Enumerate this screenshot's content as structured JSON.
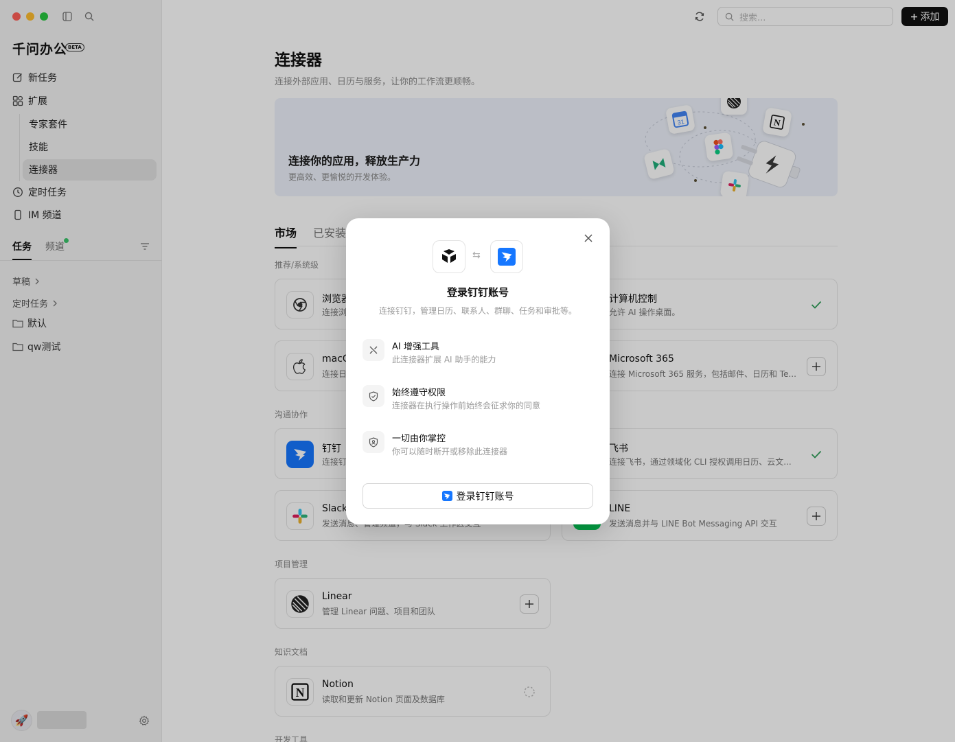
{
  "app": {
    "name": "千问办公",
    "badge": "BETA"
  },
  "sidebar": {
    "nav": {
      "new_task": "新任务",
      "extensions": "扩展",
      "scheduled": "定时任务",
      "im_channel": "IM 频道"
    },
    "sub": {
      "expert_kits": "专家套件",
      "skills": "技能",
      "connectors": "连接器"
    },
    "tabs": {
      "tasks": "任务",
      "channels": "频道"
    },
    "lists": {
      "drafts": "草稿",
      "scheduled": "定时任务",
      "default": "默认",
      "qw_test": "qw测试"
    }
  },
  "topbar": {
    "search_placeholder": "搜索...",
    "add_label": "添加"
  },
  "page": {
    "title": "连接器",
    "subtitle": "连接外部应用、日历与服务，让你的工作流更顺畅。",
    "banner": {
      "title": "连接你的应用，释放生产力",
      "subtitle": "更高效、更愉悦的开发体验。"
    },
    "tabs": {
      "market": "市场",
      "installed": "已安装"
    },
    "sections": {
      "recommended": "推荐/系统级",
      "communication": "沟通协作",
      "project": "项目管理",
      "knowledge": "知识文档",
      "dev": "开发工具"
    },
    "cards": {
      "browser": {
        "name": "浏览器",
        "desc": "连接浏"
      },
      "computer": {
        "name": "计算机控制",
        "desc": "允许 AI 操作桌面。"
      },
      "macos": {
        "name": "macO",
        "desc": "连接日"
      },
      "ms365": {
        "name": "Microsoft 365",
        "desc": "连接 Microsoft 365 服务，包括邮件、日历和 Te..."
      },
      "dingtalk": {
        "name": "钉钉",
        "desc": "连接钉"
      },
      "feishu": {
        "name": "飞书",
        "desc": "连接飞书，通过领域化 CLI 授权调用日历、云文..."
      },
      "slack": {
        "name": "Slack",
        "desc": "发送消息、管理频道，与 Slack 工作区交互"
      },
      "line": {
        "name": "LINE",
        "desc": "发送消息并与 LINE Bot Messaging API 交互"
      },
      "linear": {
        "name": "Linear",
        "desc": "管理 Linear 问题、项目和团队"
      },
      "notion": {
        "name": "Notion",
        "desc": "读取和更新 Notion 页面及数据库"
      }
    }
  },
  "modal": {
    "title": "登录钉钉账号",
    "subtitle": "连接钉钉，管理日历、联系人、群聊、任务和审批等。",
    "swap_glyph": "⇆",
    "features": [
      {
        "title": "AI 增强工具",
        "desc": "此连接器扩展 AI 助手的能力"
      },
      {
        "title": "始终遵守权限",
        "desc": "连接器在执行操作前始终会征求你的同意"
      },
      {
        "title": "一切由你掌控",
        "desc": "你可以随时断开或移除此连接器"
      }
    ],
    "button_label": "登录钉钉账号"
  },
  "colors": {
    "dingtalk_blue": "#1677ff",
    "accent_dark": "#111111",
    "online_green": "#3bc56b",
    "check_green": "#2e9e58"
  }
}
